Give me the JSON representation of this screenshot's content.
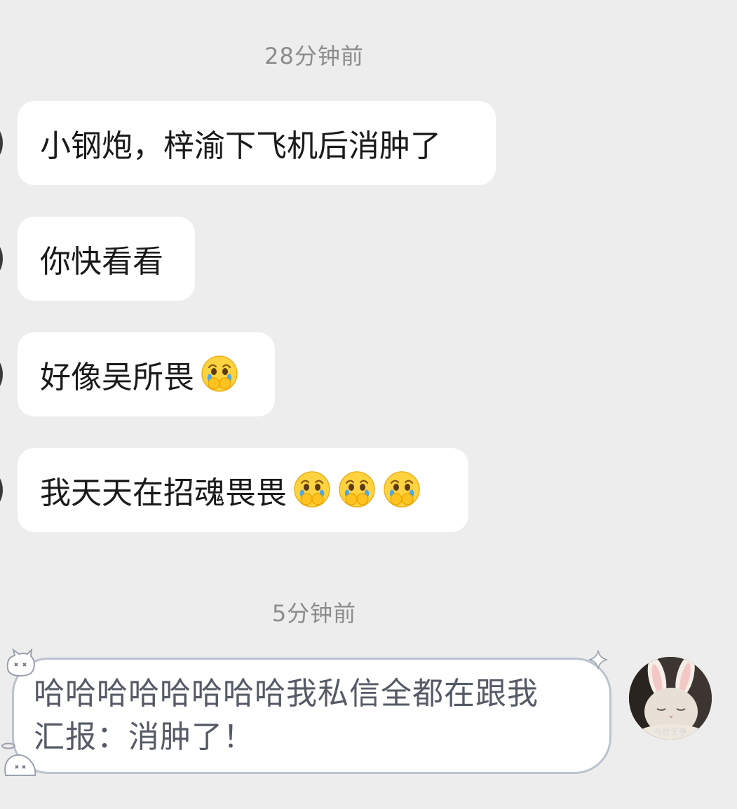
{
  "chat": {
    "groups": [
      {
        "time": "28分钟前",
        "messages": [
          {
            "text": "小钢炮，梓渝下飞机后消肿了",
            "emoji_count": 0
          },
          {
            "text": "你快看看",
            "emoji_count": 0
          },
          {
            "text": "好像吴所畏",
            "emoji_count": 1
          },
          {
            "text": "我天天在招魂畏畏",
            "emoji_count": 3
          }
        ]
      },
      {
        "time": "5分钟前",
        "outgoing": {
          "line1": "哈哈哈哈哈哈哈哈我私信全都在跟我",
          "line2": "汇报：消肿了！"
        },
        "avatar_caption": "与世无争"
      }
    ],
    "emoji_name": "cover-mouth-crying-emoji"
  },
  "colors": {
    "background": "#ededed",
    "bubble_in": "#ffffff",
    "bubble_out_border": "#bcc3cf",
    "timestamp": "#8c8c8c"
  }
}
